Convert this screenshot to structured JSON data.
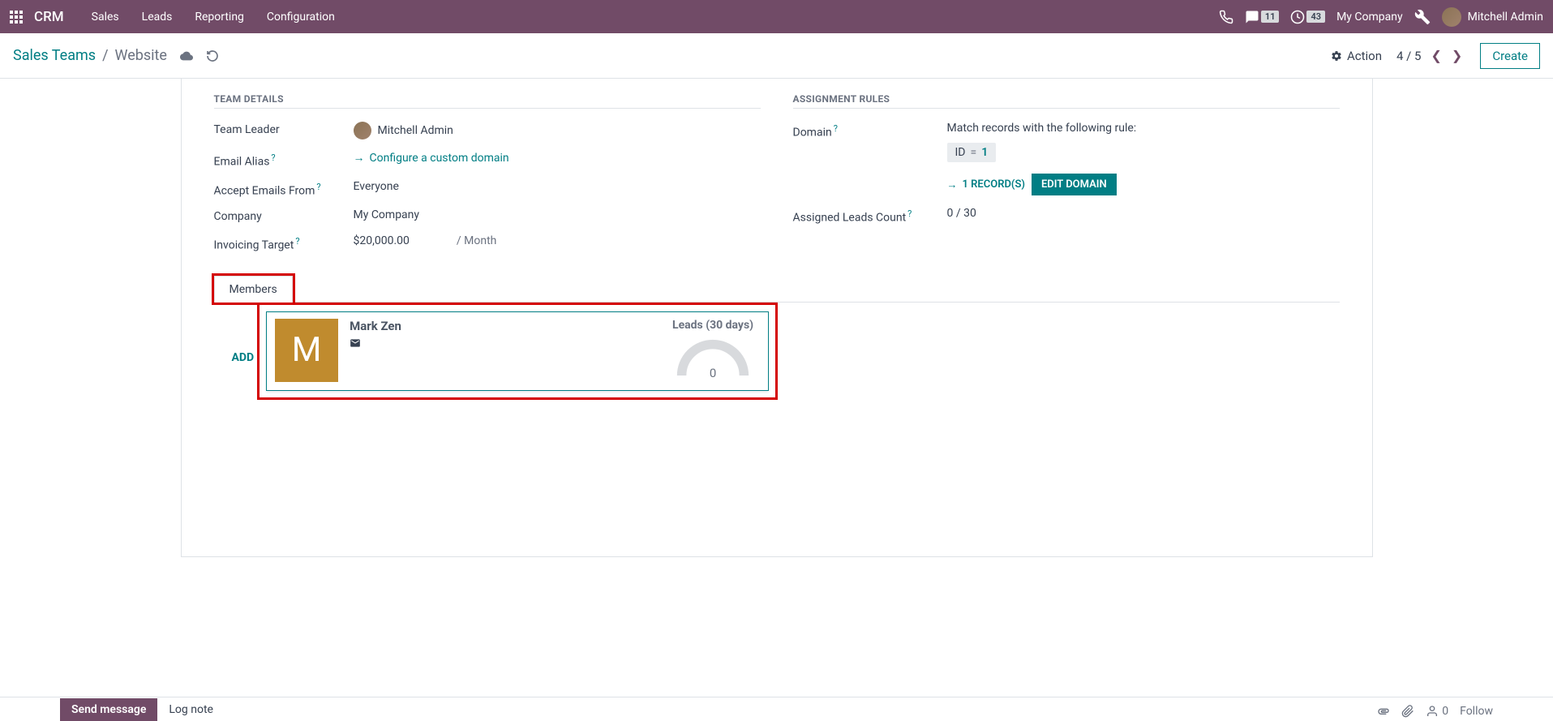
{
  "topbar": {
    "brand": "CRM",
    "nav": [
      "Sales",
      "Leads",
      "Reporting",
      "Configuration"
    ],
    "messages_count": "11",
    "activities_count": "43",
    "company": "My Company",
    "user": "Mitchell Admin"
  },
  "subbar": {
    "breadcrumb_parent": "Sales Teams",
    "breadcrumb_current": "Website",
    "action_label": "Action",
    "pager": "4 / 5",
    "create_label": "Create"
  },
  "team_details": {
    "title": "TEAM DETAILS",
    "labels": {
      "team_leader": "Team Leader",
      "email_alias": "Email Alias",
      "accept_emails": "Accept Emails From",
      "company": "Company",
      "invoicing_target": "Invoicing Target"
    },
    "values": {
      "team_leader": "Mitchell Admin",
      "configure_domain": "Configure a custom domain",
      "accept_emails": "Everyone",
      "company": "My Company",
      "invoicing_target": "$20,000.00",
      "period": "/ Month"
    }
  },
  "assignment_rules": {
    "title": "ASSIGNMENT RULES",
    "labels": {
      "domain": "Domain",
      "assigned_leads": "Assigned Leads Count"
    },
    "match_text": "Match records with the following rule:",
    "chip_field": "ID",
    "chip_op": "=",
    "chip_val": "1",
    "records_link": "1 RECORD(S)",
    "edit_domain": "EDIT DOMAIN",
    "assigned_leads_value": "0 / 30"
  },
  "tabs": {
    "members": "Members"
  },
  "members": {
    "add_label": "ADD",
    "card": {
      "initial": "M",
      "name": "Mark Zen",
      "leads_label": "Leads (30 days)",
      "leads_value": "0"
    }
  },
  "footer": {
    "send_message": "Send message",
    "log_note": "Log note",
    "follower_count": "0",
    "follow": "Follow"
  }
}
